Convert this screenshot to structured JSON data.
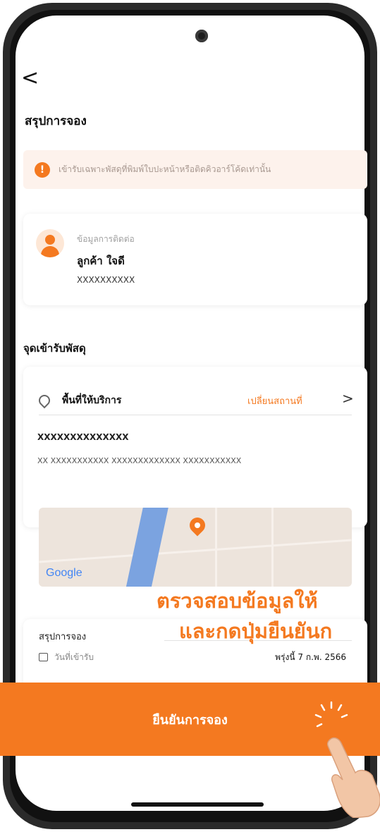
{
  "header": {
    "back_glyph": "<",
    "title": "สรุปการจอง"
  },
  "info_banner": {
    "icon": "info-icon",
    "icon_glyph": "!",
    "text": "เข้ารับเฉพาะพัสดุที่พิมพ์ใบปะหน้าหรือติดคิวอาร์โค้ดเท่านั้น"
  },
  "contact": {
    "label": "ข้อมูลการติดต่อ",
    "name": "ลูกค้า ใจดี",
    "phone": "XXXXXXXXXX"
  },
  "pickup": {
    "section_title": "จุดเข้ารับพัสดุ",
    "area_label": "พื้นที่ให้บริการ",
    "change_link": "เปลี่ยนสถานที่",
    "chevron": ">",
    "address_title": "XXXXXXXXXXXXXX",
    "address_detail": "XX XXXXXXXXXXX XXXXXXXXXXXXX XXXXXXXXXXX",
    "map_brand": "Google"
  },
  "summary": {
    "title": "สรุปการจอง",
    "date_label": "วันที่เข้ารับ",
    "date_value": "พรุ่งนี้ 7 ก.พ. 2566"
  },
  "overlay": {
    "line1": "ตรวจสอบข้อมูลให้",
    "line2": "และกดปุ่มยืนยันก"
  },
  "confirm_button": {
    "label": "ยืนยันการจอง"
  },
  "colors": {
    "accent": "#f47920",
    "info_bg": "#fdf2ec"
  }
}
